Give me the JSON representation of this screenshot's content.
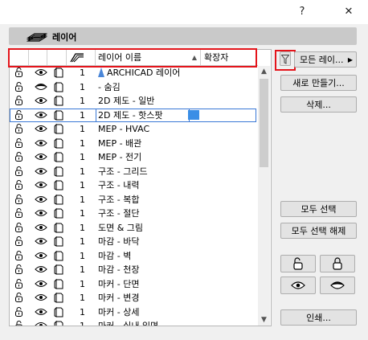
{
  "window": {
    "help": "?",
    "close": "✕"
  },
  "panel": {
    "title": "레이어"
  },
  "columns": {
    "num": "",
    "name": "레이어 이름",
    "ext": "확장자"
  },
  "filter_icon": "funnel-icon",
  "side": {
    "all_layers": "모든 레이...",
    "new": "새로 만들기...",
    "delete": "삭제...",
    "select_all": "모두 선택",
    "deselect_all": "모두 선택 해제",
    "print": "인쇄..."
  },
  "rows": [
    {
      "num": "1",
      "name": "ARCHICAD 레이어",
      "eye": "open",
      "archicad": true
    },
    {
      "num": "1",
      "name": "- 숨김",
      "eye": "closed"
    },
    {
      "num": "1",
      "name": "2D 제도 - 일반",
      "eye": "open"
    },
    {
      "num": "1",
      "name": "2D 제도 - 핫스팟",
      "eye": "open",
      "selected": true
    },
    {
      "num": "1",
      "name": "MEP - HVAC",
      "eye": "open"
    },
    {
      "num": "1",
      "name": "MEP - 배관",
      "eye": "open"
    },
    {
      "num": "1",
      "name": "MEP - 전기",
      "eye": "open"
    },
    {
      "num": "1",
      "name": "구조 - 그리드",
      "eye": "open"
    },
    {
      "num": "1",
      "name": "구조 - 내력",
      "eye": "open"
    },
    {
      "num": "1",
      "name": "구조 - 복합",
      "eye": "open"
    },
    {
      "num": "1",
      "name": "구조 - 절단",
      "eye": "open"
    },
    {
      "num": "1",
      "name": "도면 & 그림",
      "eye": "open"
    },
    {
      "num": "1",
      "name": "마감 - 바닥",
      "eye": "open"
    },
    {
      "num": "1",
      "name": "마감 - 벽",
      "eye": "open"
    },
    {
      "num": "1",
      "name": "마감 - 천장",
      "eye": "open"
    },
    {
      "num": "1",
      "name": "마커 - 단면",
      "eye": "open"
    },
    {
      "num": "1",
      "name": "마커 - 변경",
      "eye": "open"
    },
    {
      "num": "1",
      "name": "마커 - 상세",
      "eye": "open"
    },
    {
      "num": "1",
      "name": "마커 - 실내 입면",
      "eye": "open"
    }
  ],
  "colors": {
    "highlight": "#e4141b",
    "selection": "#3a78d6"
  }
}
